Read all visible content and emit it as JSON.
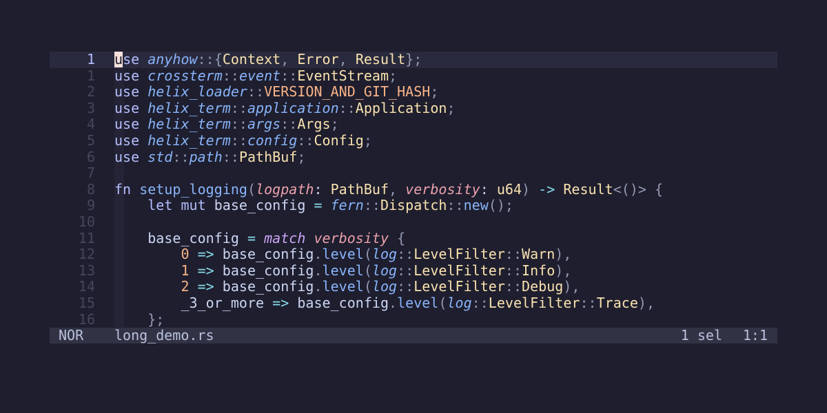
{
  "statusline": {
    "mode": "NOR",
    "filename": "long_demo.rs",
    "selections": "1 sel",
    "position": "1:1"
  },
  "gutter": [
    "1",
    "1",
    "2",
    "3",
    "4",
    "5",
    "6",
    "7",
    "8",
    "9",
    "10",
    "11",
    "12",
    "13",
    "14",
    "15",
    "16"
  ],
  "colors": {
    "background": "#1e1e2e",
    "statusline": "#313244",
    "cursorline": "#292a3d",
    "cursor": "#f5e0dc"
  },
  "lines": [
    [
      [
        "use",
        "tok-kwlight"
      ],
      [
        " ",
        "tok-plain"
      ],
      [
        "anyhow",
        "tok-ns"
      ],
      [
        "::",
        "tok-punct"
      ],
      [
        "{",
        "tok-punct"
      ],
      [
        "Context",
        "tok-type"
      ],
      [
        ", ",
        "tok-punct"
      ],
      [
        "Error",
        "tok-type"
      ],
      [
        ", ",
        "tok-punct"
      ],
      [
        "Result",
        "tok-type"
      ],
      [
        "};",
        "tok-punct"
      ]
    ],
    [
      [
        "use",
        "tok-kwlight"
      ],
      [
        " ",
        "tok-plain"
      ],
      [
        "crossterm",
        "tok-ns"
      ],
      [
        "::",
        "tok-punct"
      ],
      [
        "event",
        "tok-ns"
      ],
      [
        "::",
        "tok-punct"
      ],
      [
        "EventStream",
        "tok-type"
      ],
      [
        ";",
        "tok-punct"
      ]
    ],
    [
      [
        "use",
        "tok-kwlight"
      ],
      [
        " ",
        "tok-plain"
      ],
      [
        "helix_loader",
        "tok-ns"
      ],
      [
        "::",
        "tok-punct"
      ],
      [
        "VERSION_AND_GIT_HASH",
        "tok-const"
      ],
      [
        ";",
        "tok-punct"
      ]
    ],
    [
      [
        "use",
        "tok-kwlight"
      ],
      [
        " ",
        "tok-plain"
      ],
      [
        "helix_term",
        "tok-ns"
      ],
      [
        "::",
        "tok-punct"
      ],
      [
        "application",
        "tok-ns"
      ],
      [
        "::",
        "tok-punct"
      ],
      [
        "Application",
        "tok-type"
      ],
      [
        ";",
        "tok-punct"
      ]
    ],
    [
      [
        "use",
        "tok-kwlight"
      ],
      [
        " ",
        "tok-plain"
      ],
      [
        "helix_term",
        "tok-ns"
      ],
      [
        "::",
        "tok-punct"
      ],
      [
        "args",
        "tok-ns"
      ],
      [
        "::",
        "tok-punct"
      ],
      [
        "Args",
        "tok-type"
      ],
      [
        ";",
        "tok-punct"
      ]
    ],
    [
      [
        "use",
        "tok-kwlight"
      ],
      [
        " ",
        "tok-plain"
      ],
      [
        "helix_term",
        "tok-ns"
      ],
      [
        "::",
        "tok-punct"
      ],
      [
        "config",
        "tok-ns"
      ],
      [
        "::",
        "tok-punct"
      ],
      [
        "Config",
        "tok-type"
      ],
      [
        ";",
        "tok-punct"
      ]
    ],
    [
      [
        "use",
        "tok-kwlight"
      ],
      [
        " ",
        "tok-plain"
      ],
      [
        "std",
        "tok-ns"
      ],
      [
        "::",
        "tok-punct"
      ],
      [
        "path",
        "tok-ns"
      ],
      [
        "::",
        "tok-punct"
      ],
      [
        "PathBuf",
        "tok-type"
      ],
      [
        ";",
        "tok-punct"
      ]
    ],
    [],
    [
      [
        "fn",
        "tok-kwlight"
      ],
      [
        " ",
        "tok-plain"
      ],
      [
        "setup_logging",
        "tok-fn"
      ],
      [
        "(",
        "tok-punct"
      ],
      [
        "logpath",
        "tok-param"
      ],
      [
        ": ",
        "tok-plain"
      ],
      [
        "PathBuf",
        "tok-type"
      ],
      [
        ", ",
        "tok-punct"
      ],
      [
        "verbosity",
        "tok-param"
      ],
      [
        ": ",
        "tok-plain"
      ],
      [
        "u64",
        "tok-type"
      ],
      [
        ") ",
        "tok-punct"
      ],
      [
        "->",
        "tok-op"
      ],
      [
        " ",
        "tok-plain"
      ],
      [
        "Result",
        "tok-type"
      ],
      [
        "<()>",
        "tok-punct"
      ],
      [
        " {",
        "tok-punct"
      ]
    ],
    [
      [
        "    ",
        "tok-plain"
      ],
      [
        "let",
        "tok-kwlight"
      ],
      [
        " ",
        "tok-plain"
      ],
      [
        "mut",
        "tok-kwlight"
      ],
      [
        " base_config ",
        "tok-plain"
      ],
      [
        "=",
        "tok-op"
      ],
      [
        " ",
        "tok-plain"
      ],
      [
        "fern",
        "tok-ns"
      ],
      [
        "::",
        "tok-punct"
      ],
      [
        "Dispatch",
        "tok-type"
      ],
      [
        "::",
        "tok-punct"
      ],
      [
        "new",
        "tok-fn"
      ],
      [
        "();",
        "tok-punct"
      ]
    ],
    [],
    [
      [
        "    base_config ",
        "tok-plain"
      ],
      [
        "=",
        "tok-op"
      ],
      [
        " ",
        "tok-plain"
      ],
      [
        "match",
        "tok-match"
      ],
      [
        " ",
        "tok-plain"
      ],
      [
        "verbosity",
        "tok-param"
      ],
      [
        " {",
        "tok-punct"
      ]
    ],
    [
      [
        "        ",
        "tok-plain"
      ],
      [
        "0",
        "tok-num"
      ],
      [
        " ",
        "tok-plain"
      ],
      [
        "=>",
        "tok-op"
      ],
      [
        " base_config",
        "tok-plain"
      ],
      [
        ".",
        "tok-punct"
      ],
      [
        "level",
        "tok-fn"
      ],
      [
        "(",
        "tok-punct"
      ],
      [
        "log",
        "tok-ns"
      ],
      [
        "::",
        "tok-punct"
      ],
      [
        "LevelFilter",
        "tok-type"
      ],
      [
        "::",
        "tok-punct"
      ],
      [
        "Warn",
        "tok-type"
      ],
      [
        "),",
        "tok-punct"
      ]
    ],
    [
      [
        "        ",
        "tok-plain"
      ],
      [
        "1",
        "tok-num"
      ],
      [
        " ",
        "tok-plain"
      ],
      [
        "=>",
        "tok-op"
      ],
      [
        " base_config",
        "tok-plain"
      ],
      [
        ".",
        "tok-punct"
      ],
      [
        "level",
        "tok-fn"
      ],
      [
        "(",
        "tok-punct"
      ],
      [
        "log",
        "tok-ns"
      ],
      [
        "::",
        "tok-punct"
      ],
      [
        "LevelFilter",
        "tok-type"
      ],
      [
        "::",
        "tok-punct"
      ],
      [
        "Info",
        "tok-type"
      ],
      [
        "),",
        "tok-punct"
      ]
    ],
    [
      [
        "        ",
        "tok-plain"
      ],
      [
        "2",
        "tok-num"
      ],
      [
        " ",
        "tok-plain"
      ],
      [
        "=>",
        "tok-op"
      ],
      [
        " base_config",
        "tok-plain"
      ],
      [
        ".",
        "tok-punct"
      ],
      [
        "level",
        "tok-fn"
      ],
      [
        "(",
        "tok-punct"
      ],
      [
        "log",
        "tok-ns"
      ],
      [
        "::",
        "tok-punct"
      ],
      [
        "LevelFilter",
        "tok-type"
      ],
      [
        "::",
        "tok-punct"
      ],
      [
        "Debug",
        "tok-type"
      ],
      [
        "),",
        "tok-punct"
      ]
    ],
    [
      [
        "        _3_or_more ",
        "tok-plain"
      ],
      [
        "=>",
        "tok-op"
      ],
      [
        " base_config",
        "tok-plain"
      ],
      [
        ".",
        "tok-punct"
      ],
      [
        "level",
        "tok-fn"
      ],
      [
        "(",
        "tok-punct"
      ],
      [
        "log",
        "tok-ns"
      ],
      [
        "::",
        "tok-punct"
      ],
      [
        "LevelFilter",
        "tok-type"
      ],
      [
        "::",
        "tok-punct"
      ],
      [
        "Trace",
        "tok-type"
      ],
      [
        "),",
        "tok-punct"
      ]
    ],
    [
      [
        "    ",
        "tok-plain"
      ],
      [
        "};",
        "tok-punct"
      ]
    ]
  ]
}
